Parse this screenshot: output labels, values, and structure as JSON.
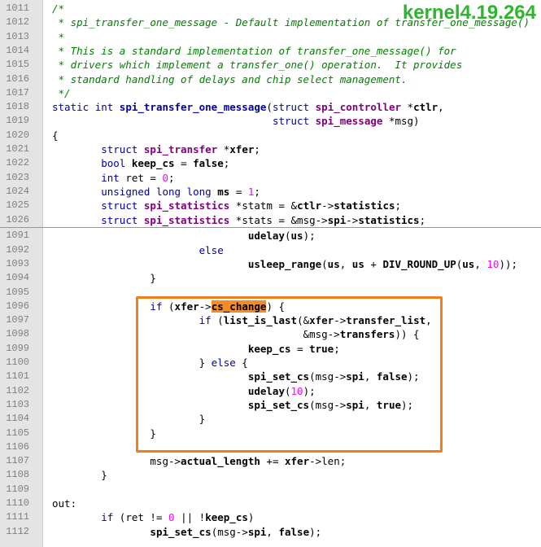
{
  "watermark": "kernel4.19.264",
  "lines": [
    {
      "n": "1011",
      "code": "/*",
      "cls": "cm",
      "indent": 0
    },
    {
      "n": "1012",
      "code": " * spi_transfer_one_message - Default implementation of transfer_one_message()",
      "cls": "cm",
      "indent": 0
    },
    {
      "n": "1013",
      "code": " *",
      "cls": "cm",
      "indent": 0
    },
    {
      "n": "1014",
      "code": " * This is a standard implementation of transfer_one_message() for",
      "cls": "cm",
      "indent": 0
    },
    {
      "n": "1015",
      "code": " * drivers which implement a transfer_one() operation.  It provides",
      "cls": "cm",
      "indent": 0
    },
    {
      "n": "1016",
      "code": " * standard handling of delays and chip select management.",
      "cls": "cm",
      "indent": 0
    },
    {
      "n": "1017",
      "code": " */",
      "cls": "cm",
      "indent": 0
    },
    {
      "n": "1018",
      "code": "static int spi_transfer_one_message(struct spi_controller *ctlr,",
      "cls": "",
      "indent": 0
    },
    {
      "n": "1019",
      "code": "                                    struct spi_message *msg)",
      "cls": "",
      "indent": 0
    },
    {
      "n": "1020",
      "code": "{",
      "cls": "",
      "indent": 0
    },
    {
      "n": "1021",
      "code": "        struct spi_transfer *xfer;",
      "cls": "",
      "indent": 0
    },
    {
      "n": "1022",
      "code": "        bool keep_cs = false;",
      "cls": "",
      "indent": 0
    },
    {
      "n": "1023",
      "code": "        int ret = 0;",
      "cls": "",
      "indent": 0
    },
    {
      "n": "1024",
      "code": "        unsigned long long ms = 1;",
      "cls": "",
      "indent": 0
    },
    {
      "n": "1025",
      "code": "        struct spi_statistics *statm = &ctlr->statistics;",
      "cls": "",
      "indent": 0
    },
    {
      "n": "1026",
      "code": "        struct spi_statistics *stats = &msg->spi->statistics;",
      "cls": "",
      "indent": 0
    },
    {
      "n": "1091",
      "code": "                                udelay(us);",
      "cls": "",
      "indent": 0
    },
    {
      "n": "1092",
      "code": "                        else",
      "cls": "",
      "indent": 0
    },
    {
      "n": "1093",
      "code": "                                usleep_range(us, us + DIV_ROUND_UP(us, 10));",
      "cls": "",
      "indent": 0
    },
    {
      "n": "1094",
      "code": "                }",
      "cls": "",
      "indent": 0
    },
    {
      "n": "1095",
      "code": "",
      "cls": "",
      "indent": 0
    },
    {
      "n": "1096",
      "code": "                if (xfer->cs_change) {",
      "cls": "",
      "indent": 0
    },
    {
      "n": "1097",
      "code": "                        if (list_is_last(&xfer->transfer_list,",
      "cls": "",
      "indent": 0
    },
    {
      "n": "1098",
      "code": "                                         &msg->transfers)) {",
      "cls": "",
      "indent": 0
    },
    {
      "n": "1099",
      "code": "                                keep_cs = true;",
      "cls": "",
      "indent": 0
    },
    {
      "n": "1100",
      "code": "                        } else {",
      "cls": "",
      "indent": 0
    },
    {
      "n": "1101",
      "code": "                                spi_set_cs(msg->spi, false);",
      "cls": "",
      "indent": 0
    },
    {
      "n": "1102",
      "code": "                                udelay(10);",
      "cls": "",
      "indent": 0
    },
    {
      "n": "1103",
      "code": "                                spi_set_cs(msg->spi, true);",
      "cls": "",
      "indent": 0
    },
    {
      "n": "1104",
      "code": "                        }",
      "cls": "",
      "indent": 0
    },
    {
      "n": "1105",
      "code": "                }",
      "cls": "",
      "indent": 0
    },
    {
      "n": "1106",
      "code": "",
      "cls": "",
      "indent": 0
    },
    {
      "n": "1107",
      "code": "                msg->actual_length += xfer->len;",
      "cls": "",
      "indent": 0
    },
    {
      "n": "1108",
      "code": "        }",
      "cls": "",
      "indent": 0
    },
    {
      "n": "1109",
      "code": "",
      "cls": "",
      "indent": 0
    },
    {
      "n": "1110",
      "code": "out:",
      "cls": "",
      "indent": 0
    },
    {
      "n": "1111",
      "code": "        if (ret != 0 || !keep_cs)",
      "cls": "",
      "indent": 0
    },
    {
      "n": "1112",
      "code": "                spi_set_cs(msg->spi, false);",
      "cls": "",
      "indent": 0
    }
  ]
}
